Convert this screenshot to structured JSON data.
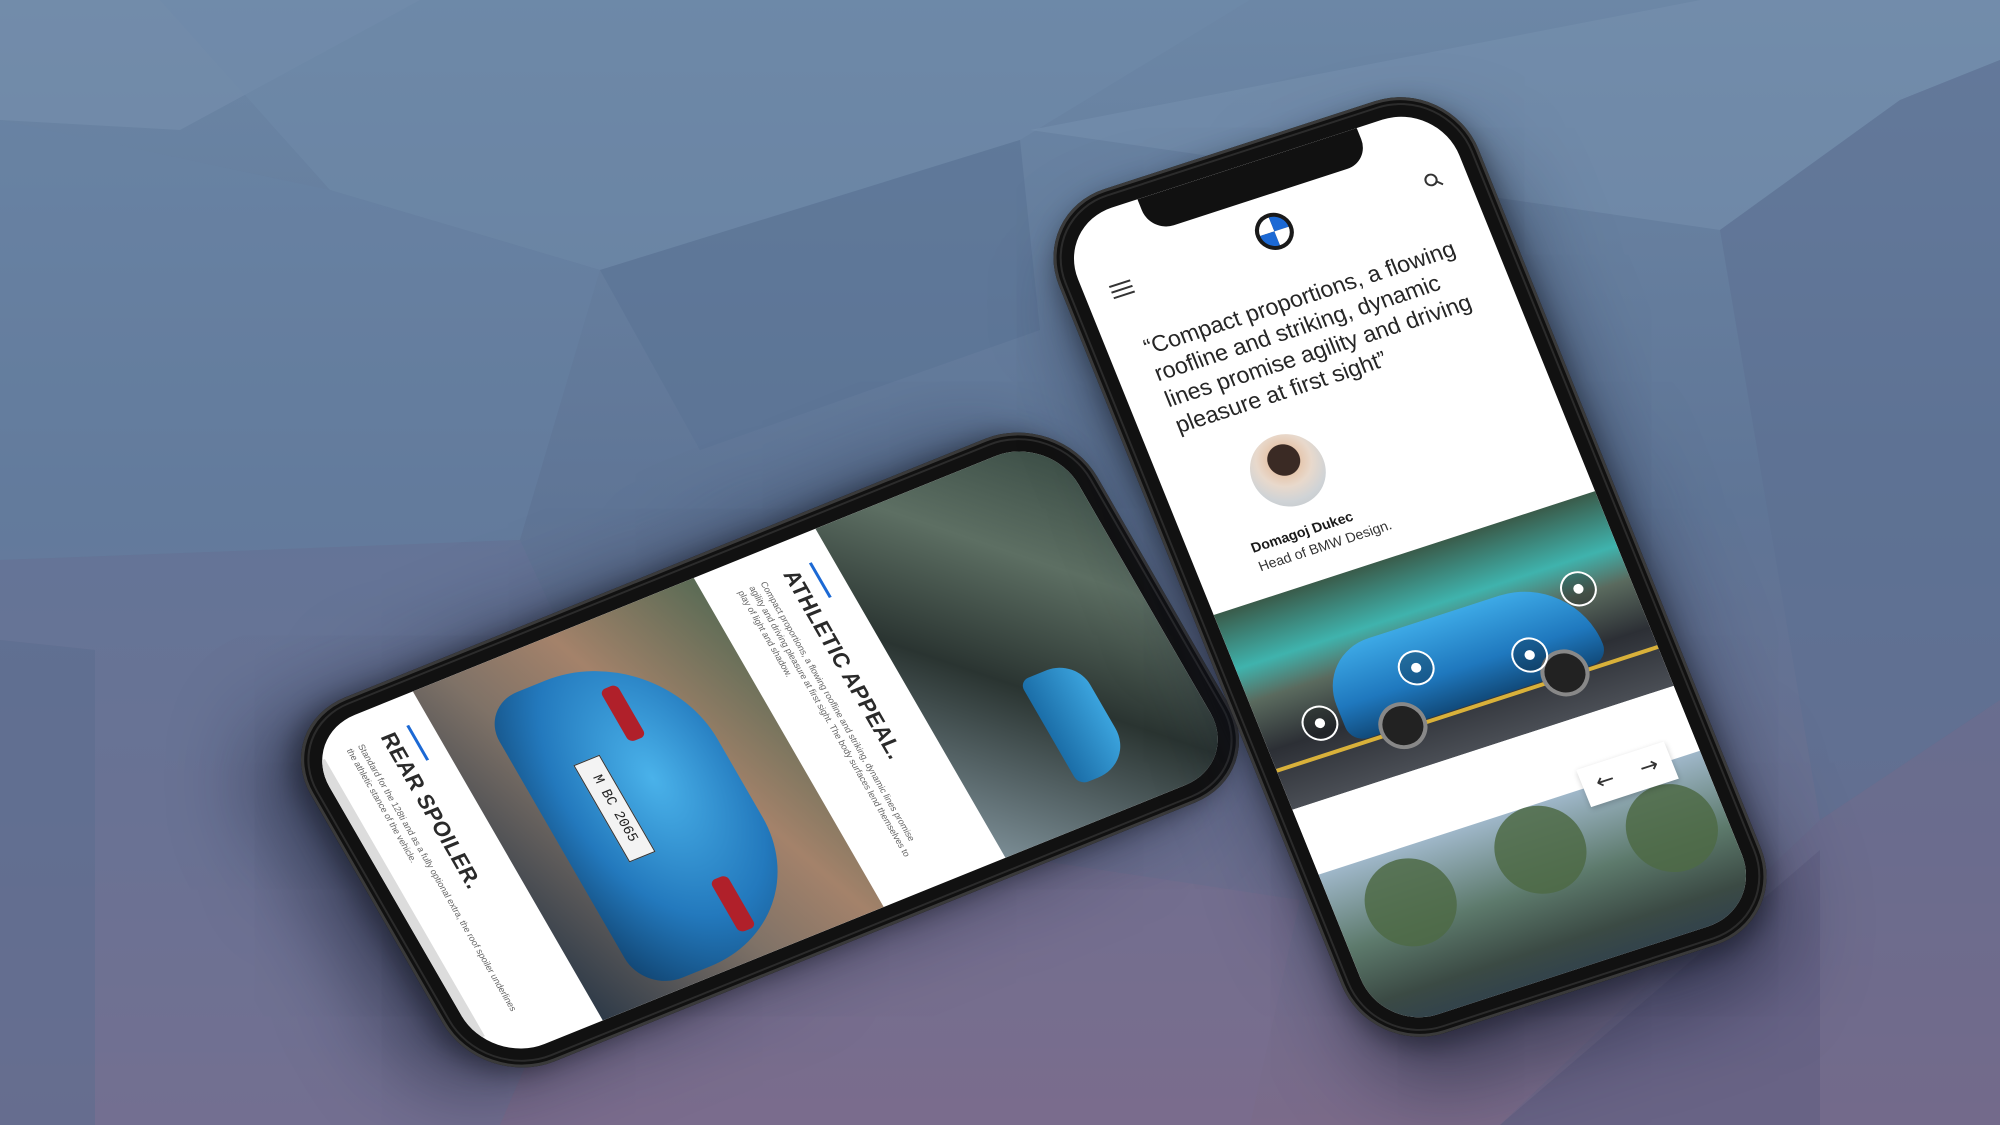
{
  "back_phone": {
    "section1_title": "ATHLETIC APPEAL.",
    "section1_body": "Compact proportions, a flowing roofline and striking, dynamic lines promise agility and driving pleasure at first sight. The body surfaces lend themselves to play of light and shadow.",
    "plate_text": "M BC 2065",
    "section2_title": "REAR SPOILER.",
    "section2_body": "Standard for the 128ti and as a fully optional extra, the roof spoiler underlines the athletic stance of the vehicle."
  },
  "front_phone": {
    "quote": "“Compact proportions, a flowing roofline and striking, dynamic lines promise agility and driving pleasure at first sight”",
    "author_name": "Domagoj Dukec",
    "author_role": "Head of BMW Design.",
    "prev_arrow": "←",
    "next_arrow": "→"
  },
  "icons": [
    "menu-icon",
    "bmw-logo-icon",
    "search-icon",
    "hotspot-icon",
    "arrow-left-icon",
    "arrow-right-icon"
  ],
  "colors": {
    "accent": "#1c69d4",
    "car_blue": "#1f78be"
  }
}
